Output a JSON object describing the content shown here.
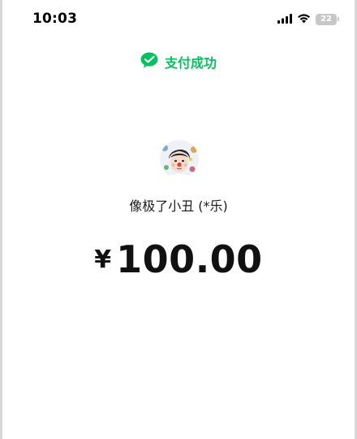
{
  "status_bar": {
    "time": "10:03",
    "battery_level": "22",
    "icons": [
      "signal-icon",
      "wifi-icon",
      "battery-icon"
    ]
  },
  "header": {
    "title": "支付成功",
    "icon": "wechat-pay-icon",
    "accent_color": "#07c160"
  },
  "payee": {
    "avatar": "avatar",
    "name": "像极了小丑 (*乐)"
  },
  "payment": {
    "currency_symbol": "¥",
    "amount": "100.00"
  }
}
